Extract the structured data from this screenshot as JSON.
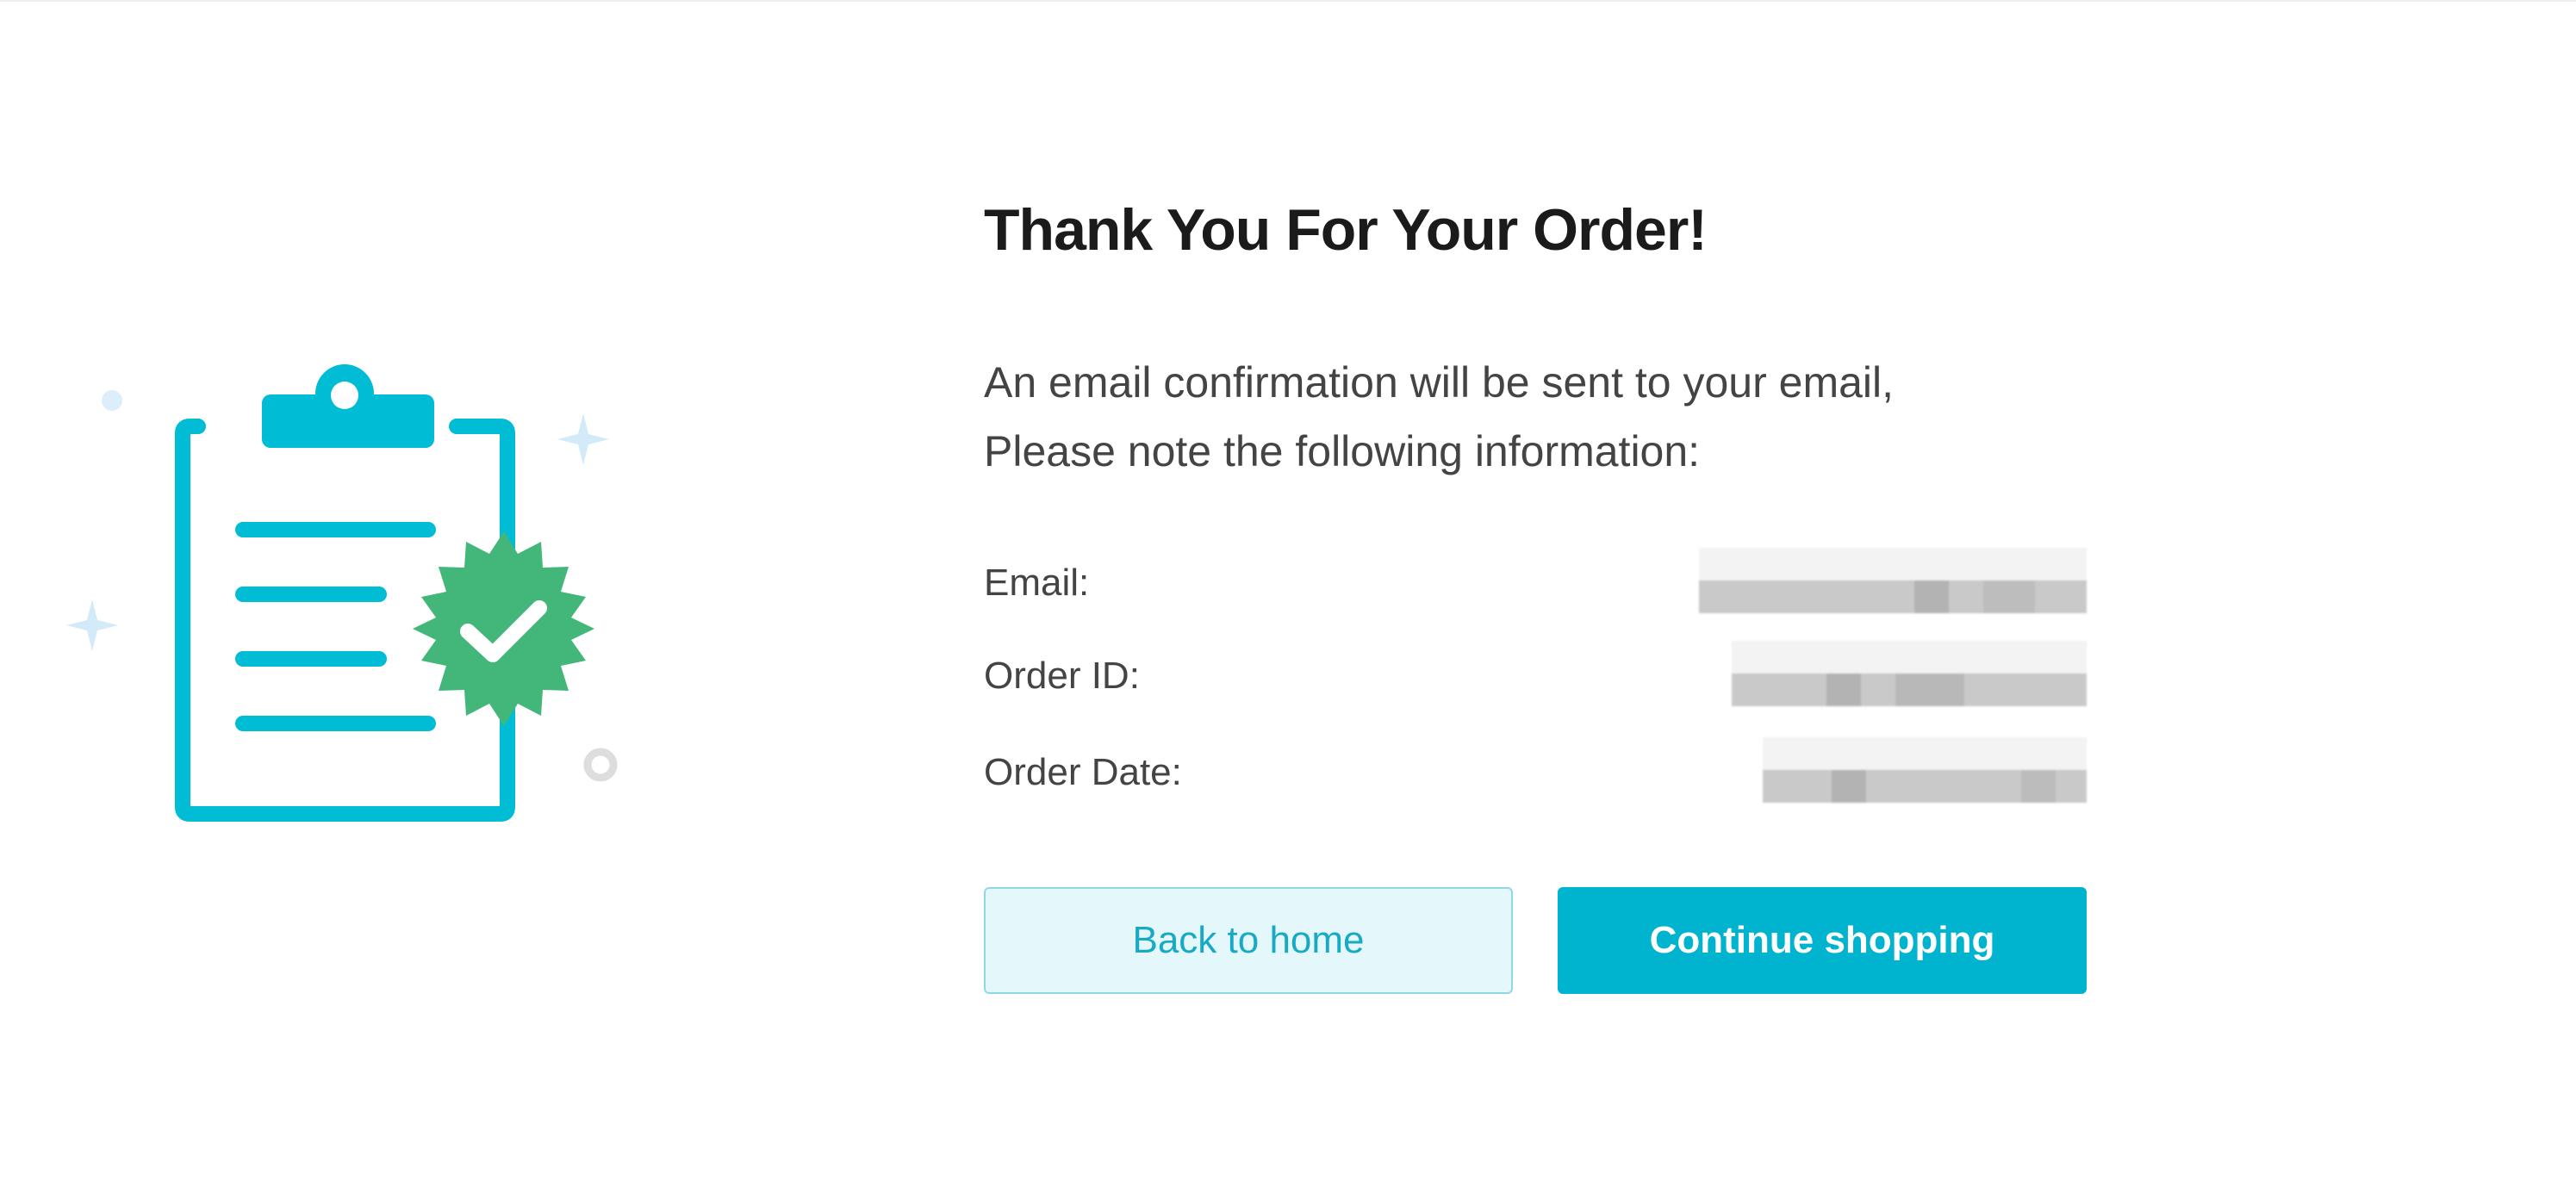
{
  "confirmation": {
    "title": "Thank You For Your Order!",
    "message_line1": "An email confirmation will be sent to your email,",
    "message_line2": "Please note the following information:"
  },
  "order_info": {
    "email_label": "Email:",
    "order_id_label": "Order ID:",
    "order_date_label": "Order Date:"
  },
  "actions": {
    "back_home_label": "Back to home",
    "continue_shopping_label": "Continue shopping"
  },
  "illustration": {
    "icon": "clipboard-with-verified-check",
    "clipboard_color": "#00bcd4",
    "badge_color": "#43b77a",
    "sparkle_color": "#cfe8f7"
  },
  "colors": {
    "primary": "#00b4cf",
    "primary_light": "#e4f7fa",
    "title_text": "#1b1b1b",
    "body_text": "#444444"
  }
}
